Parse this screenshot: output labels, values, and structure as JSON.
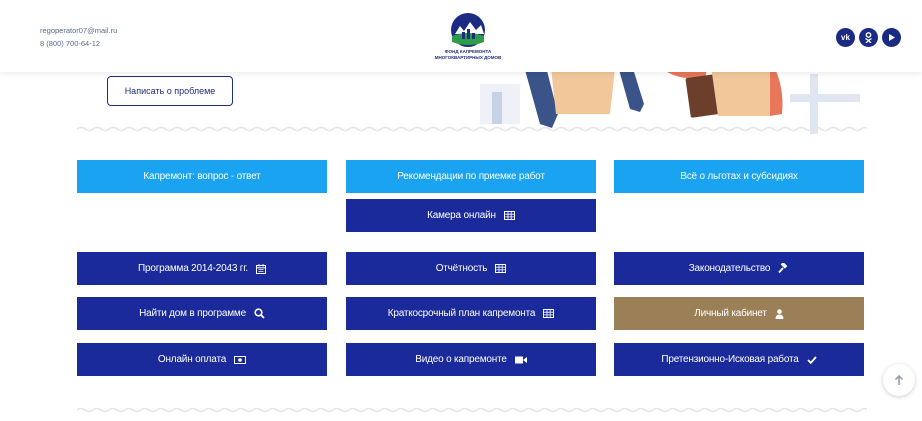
{
  "header": {
    "email": "regoperator07@mail.ru",
    "phone": "8 (800) 700-64-12",
    "logo_text": "ФОНД КАПРЕМОНТА\nМНОГОКВАРТИРНЫХ ДОМОВ",
    "social": [
      {
        "icon": "vk-icon",
        "glyph": "vk"
      },
      {
        "icon": "odnoklassniki-icon",
        "glyph": "ок"
      },
      {
        "icon": "youtube-icon",
        "glyph": "▶"
      }
    ]
  },
  "report_button": "Написать о проблеме",
  "buttons": {
    "faq": "Капремонт: вопрос - ответ",
    "recommendations": "Рекомендации по приемке работ",
    "benefits": "Всё о льготах и субсидиях",
    "camera": "Камера онлайн",
    "program": "Программа 2014-2043 гг.",
    "reports": "Отчётность",
    "legislation": "Законодательство",
    "find_house": "Найти дом в программе",
    "short_plan": "Краткосрочный план капремонта",
    "cabinet": "Личный кабинет",
    "payment": "Онлайн оплата",
    "video": "Видео о капремонте",
    "claims": "Претензионно-Исковая работа"
  },
  "colors": {
    "light_button": "#1aa3f0",
    "dark_button": "#1b2a9a",
    "cabinet_button": "#9b8057"
  }
}
